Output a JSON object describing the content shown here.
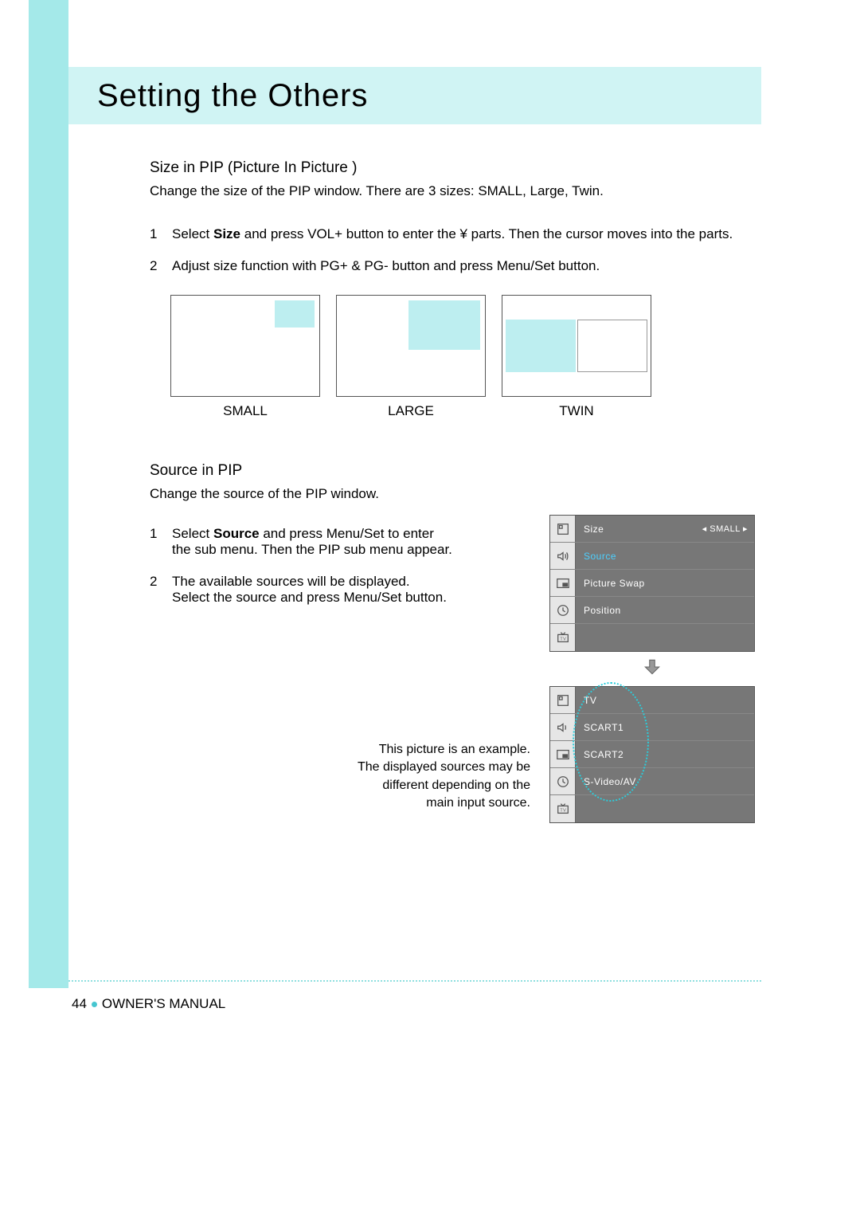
{
  "title": "Setting the Others",
  "section1": {
    "title": "Size in PIP (Picture In Picture )",
    "desc": "Change the size of the PIP window. There are 3 sizes: SMALL, Large, Twin.",
    "steps": [
      {
        "num": "1",
        "a": "Select ",
        "b": "Size",
        "c": " and press VOL+ button to enter the  ¥      parts. Then the cursor moves into the parts."
      },
      {
        "num": "2",
        "a": "Adjust size function with PG+ & PG- button and press Menu/Set button.",
        "b": "",
        "c": ""
      }
    ],
    "labels": {
      "small": "SMALL",
      "large": "LARGE",
      "twin": "TWIN"
    }
  },
  "section2": {
    "title": "Source in PIP",
    "desc": "Change the source of the PIP window.",
    "steps": [
      {
        "num": "1",
        "a": "Select ",
        "b": "Source",
        "c": " and press Menu/Set to enter the sub menu. Then the PIP sub menu appear."
      },
      {
        "num": "2",
        "a": "The available sources will be displayed.\nSelect the source and press Menu/Set button.",
        "b": "",
        "c": ""
      }
    ]
  },
  "osd1": {
    "rows": [
      {
        "icon": "screen",
        "label": "Size",
        "val": "◂ SMALL ▸",
        "hl": false
      },
      {
        "icon": "speaker",
        "label": "Source",
        "val": "",
        "hl": true
      },
      {
        "icon": "pip",
        "label": "Picture Swap",
        "val": "",
        "hl": false
      },
      {
        "icon": "clock",
        "label": "Position",
        "val": "",
        "hl": false
      },
      {
        "icon": "tv",
        "label": "",
        "val": "",
        "hl": false
      }
    ]
  },
  "osd2": {
    "rows": [
      {
        "icon": "screen",
        "label": "TV"
      },
      {
        "icon": "speaker",
        "label": "SCART1"
      },
      {
        "icon": "pip",
        "label": "SCART2"
      },
      {
        "icon": "clock",
        "label": "S-Video/AV"
      },
      {
        "icon": "tv",
        "label": ""
      }
    ]
  },
  "example_note": "This picture is an example.\nThe displayed sources may be\ndifferent depending on the\nmain input source.",
  "footer": {
    "page": "44",
    "label": "OWNER'S MANUAL"
  }
}
